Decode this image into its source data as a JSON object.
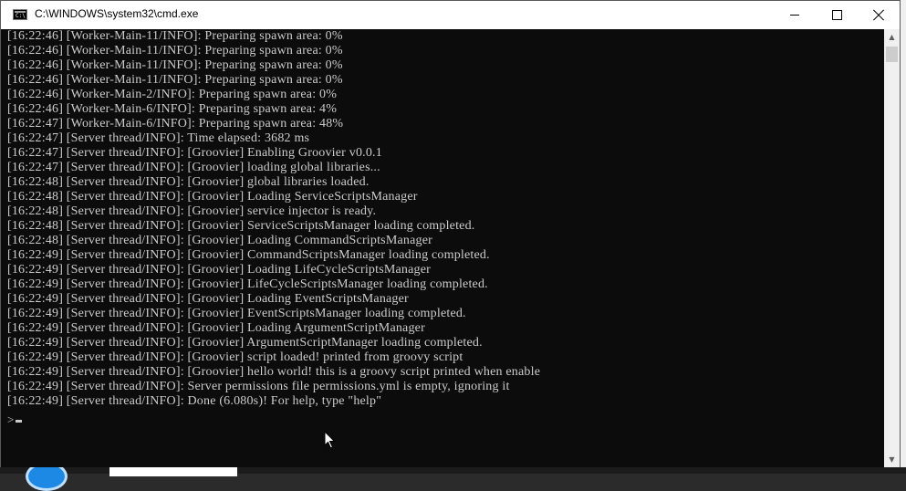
{
  "window": {
    "title": "C:\\WINDOWS\\system32\\cmd.exe",
    "icon_label": "C:\\"
  },
  "console": {
    "lines": [
      "[16:22:46] [Worker-Main-11/INFO]: Preparing spawn area: 0%",
      "[16:22:46] [Worker-Main-11/INFO]: Preparing spawn area: 0%",
      "[16:22:46] [Worker-Main-11/INFO]: Preparing spawn area: 0%",
      "[16:22:46] [Worker-Main-11/INFO]: Preparing spawn area: 0%",
      "[16:22:46] [Worker-Main-2/INFO]: Preparing spawn area: 0%",
      "[16:22:46] [Worker-Main-6/INFO]: Preparing spawn area: 4%",
      "[16:22:47] [Worker-Main-6/INFO]: Preparing spawn area: 48%",
      "[16:22:47] [Server thread/INFO]: Time elapsed: 3682 ms",
      "[16:22:47] [Server thread/INFO]: [Groovier] Enabling Groovier v0.0.1",
      "[16:22:47] [Server thread/INFO]: [Groovier] loading global libraries...",
      "[16:22:48] [Server thread/INFO]: [Groovier] global libraries loaded.",
      "[16:22:48] [Server thread/INFO]: [Groovier] Loading ServiceScriptsManager",
      "[16:22:48] [Server thread/INFO]: [Groovier] service injector is ready.",
      "[16:22:48] [Server thread/INFO]: [Groovier] ServiceScriptsManager loading completed.",
      "[16:22:48] [Server thread/INFO]: [Groovier] Loading CommandScriptsManager",
      "[16:22:49] [Server thread/INFO]: [Groovier] CommandScriptsManager loading completed.",
      "[16:22:49] [Server thread/INFO]: [Groovier] Loading LifeCycleScriptsManager",
      "[16:22:49] [Server thread/INFO]: [Groovier] LifeCycleScriptsManager loading completed.",
      "[16:22:49] [Server thread/INFO]: [Groovier] Loading EventScriptsManager",
      "[16:22:49] [Server thread/INFO]: [Groovier] EventScriptsManager loading completed.",
      "[16:22:49] [Server thread/INFO]: [Groovier] Loading ArgumentScriptManager",
      "[16:22:49] [Server thread/INFO]: [Groovier] ArgumentScriptManager loading completed.",
      "[16:22:49] [Server thread/INFO]: [Groovier] script loaded! printed from groovy script",
      "[16:22:49] [Server thread/INFO]: [Groovier] hello world! this is a groovy script printed when enable",
      "[16:22:49] [Server thread/INFO]: Server permissions file permissions.yml is empty, ignoring it",
      "[16:22:49] [Server thread/INFO]: Done (6.080s)! For help, type \"help\""
    ],
    "prompt": ">"
  },
  "colors": {
    "console_background": "#0c0c0c",
    "console_text": "#cccccc",
    "titlebar_background": "#ffffff"
  },
  "icons": {
    "minimize": "minimize-icon",
    "maximize": "maximize-icon",
    "close": "close-icon",
    "scroll_up": "scroll-up-arrow-icon",
    "scroll_down": "scroll-down-arrow-icon"
  }
}
